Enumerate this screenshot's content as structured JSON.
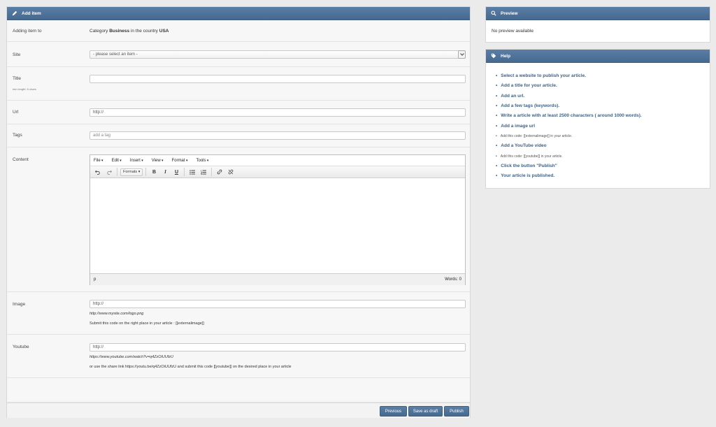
{
  "add_item": {
    "title": "Add item",
    "adding_label": "Adding item to",
    "adding_prefix": "Category",
    "category": "Business",
    "adding_mid": "in the country",
    "country": "USA",
    "site_label": "Site",
    "site_placeholder": "- please select an item -",
    "title_label": "Title",
    "title_hint": "min length: 5 chars",
    "title_value": "",
    "url_label": "Url",
    "url_value": "http://",
    "tags_label": "Tags",
    "tags_placeholder": "add a tag",
    "content_label": "Content",
    "image_label": "Image",
    "image_value": "http://",
    "image_example": "http://www.mysite.com/logo.png",
    "image_note": "Submit this code on the right place in your article : [[externalimage]]",
    "youtube_label": "Youtube",
    "youtube_value": "http://",
    "youtube_example": "https://www.youtube.com/watch?v=q4ZzOiUUfzU",
    "youtube_note": "or use the share link https://youtu.be/q4ZzOiUUfzU and submit this code [[youtube]] on the desired place in your article"
  },
  "editor": {
    "menu": [
      "File",
      "Edit",
      "Insert",
      "View",
      "Format",
      "Tools"
    ],
    "formats_label": "Formats",
    "path": "p",
    "words": "Words: 0"
  },
  "buttons": {
    "previous": "Previous",
    "save_draft": "Save as draft",
    "publish": "Publish"
  },
  "preview": {
    "title": "Preview",
    "text": "No preview available"
  },
  "help": {
    "title": "Help",
    "items": [
      "Select a website to publish your article.",
      "Add a title for your article.",
      "Add an url.",
      "Add a few tags (keywords).",
      "Write a article with at least 2500 characters ( around 1000 words).",
      "Add a image url",
      "Add this code: [[externalimage]] in your article.",
      "Add a YouTube video",
      "Add this code: [[youtube]] in your article.",
      "Click the button \"Publish\"",
      "Your article is published."
    ]
  },
  "colors": {
    "header": "#4f7399",
    "link": "#3d6289"
  }
}
